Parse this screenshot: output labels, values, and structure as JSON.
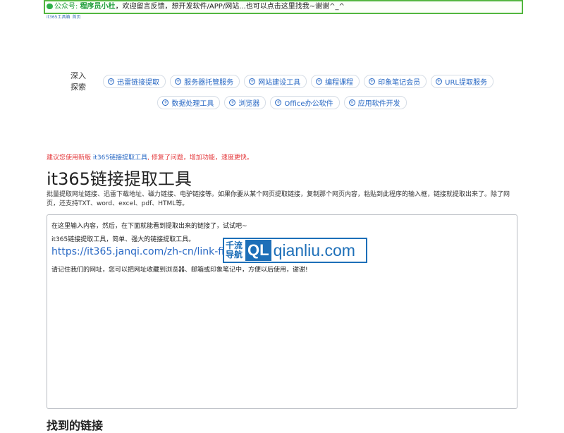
{
  "notice": {
    "prefix": "公众号: ",
    "name": "程序员小杜",
    "text": "，欢迎留言反馈，想开发软件/APP/网站...也可以点击这里找我~谢谢^_^"
  },
  "breadcrumb": [
    "it365工具箱",
    "首页"
  ],
  "explore": {
    "title": "深入探索",
    "row1": [
      "迅雷链接提取",
      "服务器托管服务",
      "网站建设工具",
      "编程课程",
      "印象笔记会员",
      "URL提取服务"
    ],
    "row2": [
      "数据处理工具",
      "浏览器",
      "Office办公软件",
      "应用软件开发"
    ]
  },
  "recommend": {
    "before": "建议您使用新版 ",
    "link": "it365链接提取工具",
    "after": ", 修复了问题，增加功能，速度更快。"
  },
  "page_title": "it365链接提取工具",
  "description": "批量提取网址链接、迅雷下载地址、磁力链接、电驴链接等。如果你要从某个网页提取链接，复制那个网页内容，粘贴到此程序的输入框，链接就提取出来了。除了网页，还支持TXT、word、excel、pdf、HTML等。",
  "textarea": {
    "line1": "在这里输入内容，然后，在下面就能看到提取出来的链接了，试试吧~",
    "line2": "it365链接提取工具，简单、强大的链接提取工具。",
    "url": "https://it365.janqi.com/zh-cn/link-finder",
    "line4": "请记住我们的网址，您可以把网址收藏到浏览器、邮箱或印象笔记中，方便以后使用，谢谢!"
  },
  "watermark": {
    "cn_line1": "千流",
    "cn_line2": "导航",
    "logo_letters": "QL",
    "domain": "qianliu.com"
  },
  "found_title": "找到的链接"
}
